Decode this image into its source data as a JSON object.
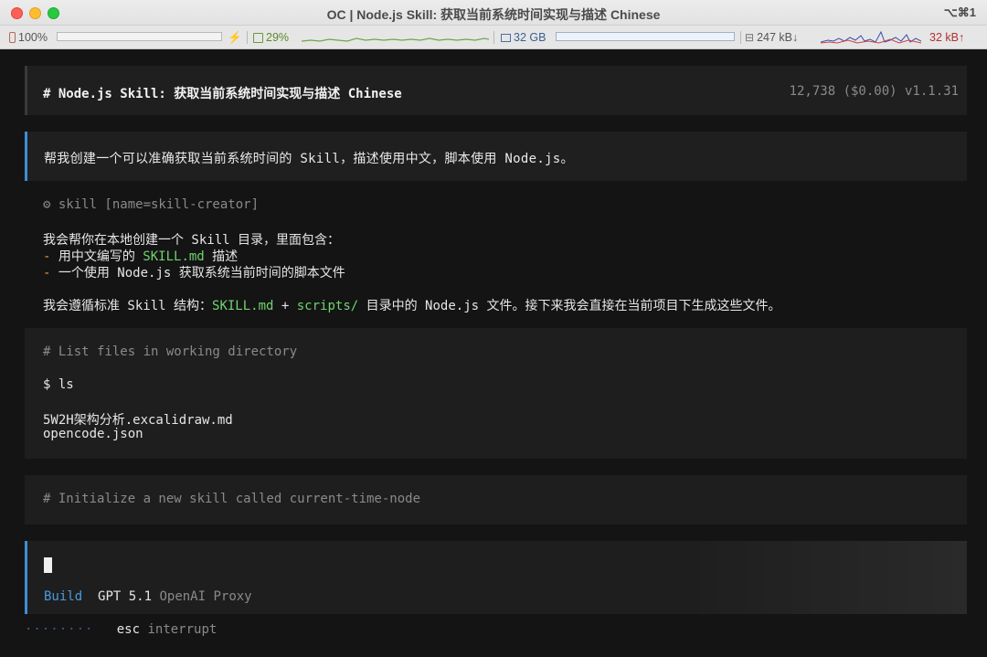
{
  "window": {
    "title": "OC | Node.js Skill: 获取当前系统时间实现与描述 Chinese",
    "shortcut": "⌥⌘1"
  },
  "statusbar": {
    "battery": "100%",
    "cpu": "29%",
    "memory": "32 GB",
    "net_down": "247 kB↓",
    "net_up": "32 kB↑",
    "lightning_glyph": "⚡"
  },
  "session": {
    "title": "# Node.js Skill: 获取当前系统时间实现与描述 Chinese",
    "meta": "12,738 ($0.00) v1.1.31"
  },
  "user_prompt": "帮我创建一个可以准确获取当前系统时间的 Skill，描述使用中文，脚本使用 Node.js。",
  "tool_call": "⚙ skill [name=skill-creator]",
  "response": {
    "line1": "我会帮你在本地创建一个 Skill 目录，里面包含：",
    "bullet_marker": "-",
    "bullet1_pre": " 用中文编写的 ",
    "bullet1_hl": "SKILL.md",
    "bullet1_post": " 描述",
    "bullet2": " 一个使用 Node.js 获取系统当前时间的脚本文件",
    "line4_pre": "我会遵循标准 Skill 结构：",
    "line4_hl1": "SKILL.md",
    "line4_plus": " + ",
    "line4_hl2": "scripts/",
    "line4_post": " 目录中的 Node.js 文件。接下来我会直接在当前项目下生成这些文件。"
  },
  "bash_block": {
    "comment": "# List files in working directory",
    "command": "$ ls",
    "output": [
      "5W2H架构分析.excalidraw.md",
      "opencode.json"
    ]
  },
  "bash_block2": {
    "comment": "# Initialize a new skill called current-time-node"
  },
  "input": {
    "agent": "Build",
    "model": "GPT 5.1",
    "provider": "OpenAI Proxy"
  },
  "footer": {
    "spinner": "········",
    "key": "esc",
    "action": "interrupt"
  },
  "colors": {
    "accent": "#3d8fd6",
    "highlight": "#6fd46f",
    "bullet": "#e0a040"
  }
}
